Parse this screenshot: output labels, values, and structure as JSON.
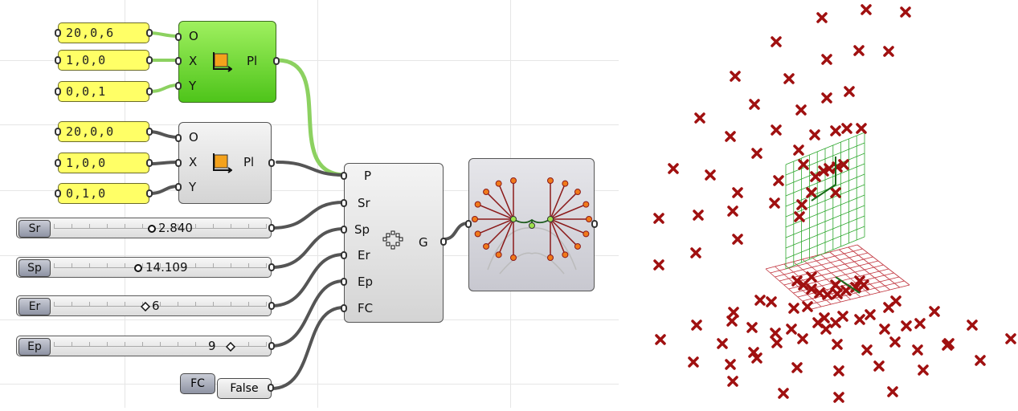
{
  "plane_a": {
    "origin": "20,0,6",
    "x_axis": "1,0,0",
    "y_axis": "0,0,1"
  },
  "plane_b": {
    "origin": "20,0,0",
    "x_axis": "1,0,0",
    "y_axis": "0,1,0"
  },
  "plane_component": {
    "input_o": "O",
    "input_x": "X",
    "input_y": "Y",
    "output": "Pl"
  },
  "sliders": [
    {
      "name": "Sr",
      "value": "2.840",
      "fill": 0.55
    },
    {
      "name": "Sp",
      "value": "14.109",
      "fill": 0.45
    },
    {
      "name": "Er",
      "value": "6",
      "fill": 0.48
    },
    {
      "name": "Ep",
      "value": "9",
      "fill": 0.88
    }
  ],
  "toggle": {
    "name": "FC",
    "value": "False"
  },
  "main_component": {
    "inputs": [
      "P",
      "Sr",
      "Sp",
      "Er",
      "Ep",
      "FC"
    ],
    "output": "G",
    "icon": "ring-points-icon"
  },
  "preview_component": {
    "icon": "branching-curves-preview"
  },
  "viewport": {
    "marker_color": "#a01010",
    "grid_vertical_color": "#2fa82f",
    "grid_horizontal_color": "#c0303a"
  }
}
